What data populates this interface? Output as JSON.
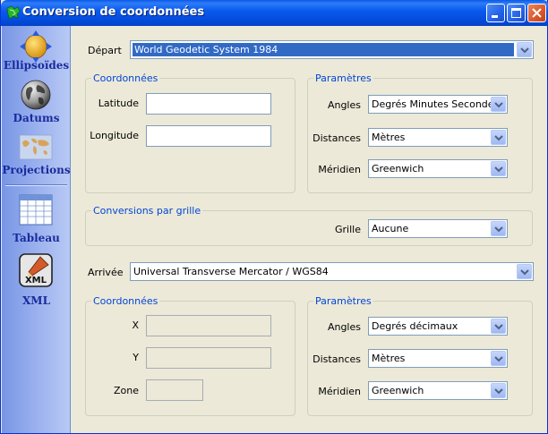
{
  "window": {
    "title": "Conversion de coordonnées"
  },
  "sidebar": {
    "items": [
      {
        "label": "Ellipsoïdes",
        "icon": "ellipsoid-icon"
      },
      {
        "label": "Datums",
        "icon": "globe-icon"
      },
      {
        "label": "Projections",
        "icon": "map-icon"
      },
      {
        "label": "Tableau",
        "icon": "table-icon"
      },
      {
        "label": "XML",
        "icon": "xml-icon"
      }
    ]
  },
  "departure": {
    "label": "Départ",
    "datum": "World Geodetic System 1984",
    "coordinates": {
      "title": "Coordonnées",
      "latitude_label": "Latitude",
      "latitude_value": "",
      "longitude_label": "Longitude",
      "longitude_value": ""
    },
    "parameters": {
      "title": "Paramètres",
      "angles_label": "Angles",
      "angles_value": "Degrés Minutes Secondes",
      "distances_label": "Distances",
      "distances_value": "Mètres",
      "meridian_label": "Méridien",
      "meridian_value": "Greenwich"
    }
  },
  "grid_conversions": {
    "title": "Conversions par grille",
    "grid_label": "Grille",
    "grid_value": "Aucune"
  },
  "arrival": {
    "label": "Arrivée",
    "projection": "Universal Transverse Mercator / WGS84",
    "coordinates": {
      "title": "Coordonnées",
      "x_label": "X",
      "y_label": "Y",
      "zone_label": "Zone"
    },
    "parameters": {
      "title": "Paramètres",
      "angles_label": "Angles",
      "angles_value": "Degrés décimaux",
      "distances_label": "Distances",
      "distances_value": "Mètres",
      "meridian_label": "Méridien",
      "meridian_value": "Greenwich"
    }
  },
  "colors": {
    "titlebar": "#0a5bef",
    "sidebar": "#9db3ef",
    "group_title": "#0046d5",
    "selection": "#316ac5"
  }
}
